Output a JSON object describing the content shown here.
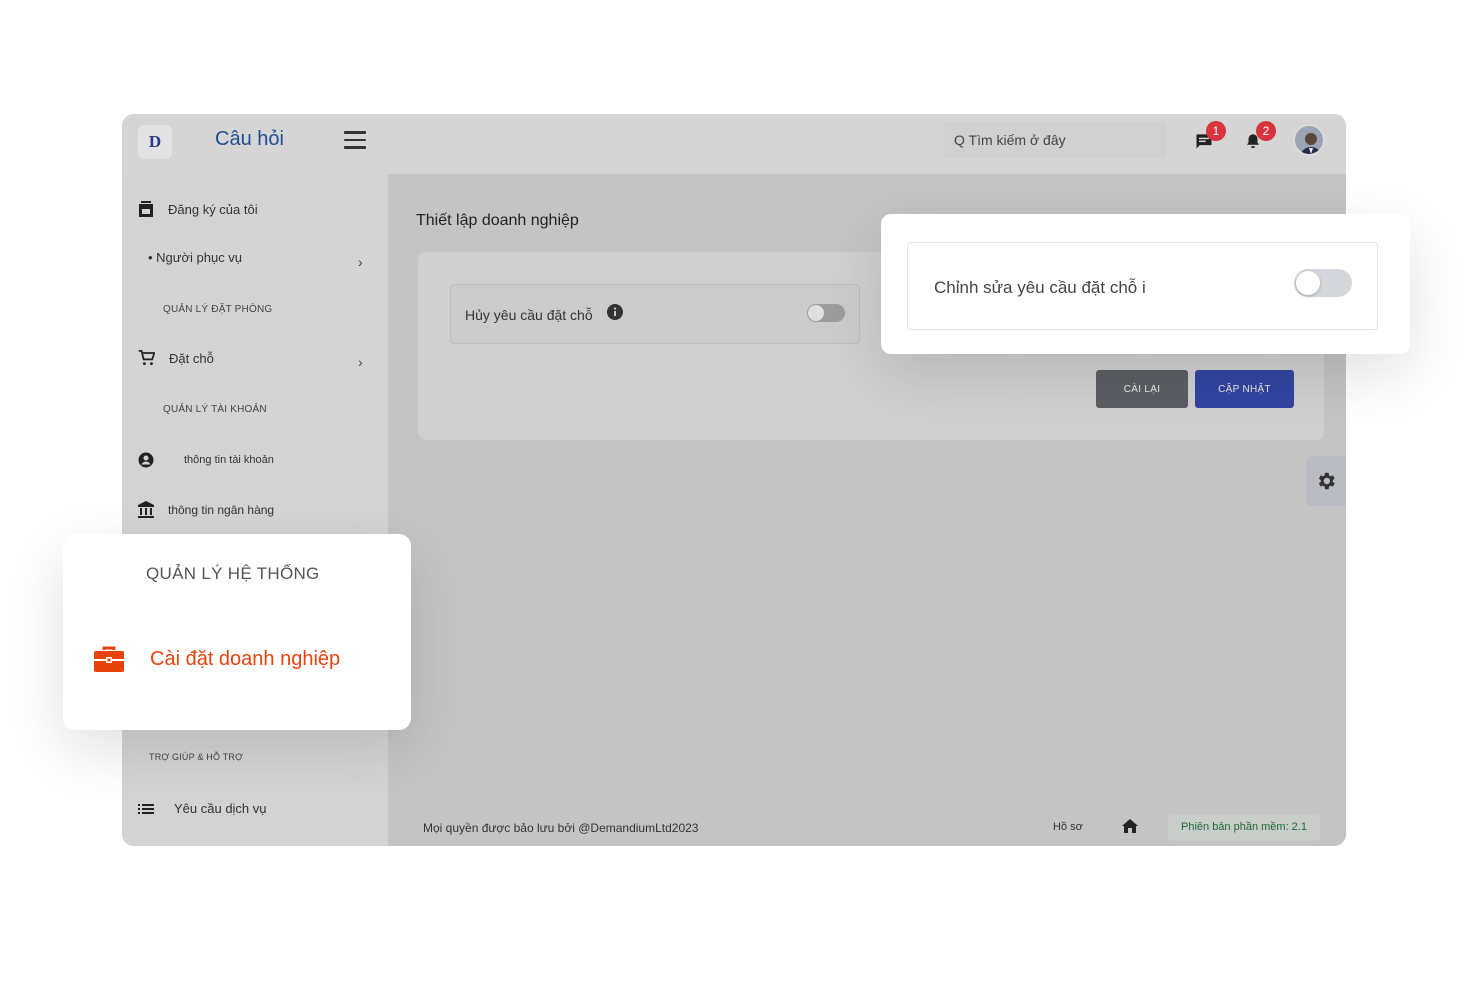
{
  "header": {
    "logo_text": "D",
    "title": "Câu hỏi",
    "search_placeholder": "Q Tìm kiếm ở đây",
    "messages_count": "1",
    "notifications_count": "2"
  },
  "sidebar": {
    "my_registration": "Đăng ký của tôi",
    "servers": "• Người phục vụ",
    "section_booking": "QUẢN LÝ ĐẶT PHÒNG",
    "booking": "Đặt chỗ",
    "section_account": "QUẢN LÝ TÀI KHOẢN",
    "account_info": "thông tin tài khoản",
    "bank_info": "thông tin ngân hàng",
    "section_support": "TRỢ GIÚP & HỖ TRỢ",
    "service_request": "Yêu cầu dịch vụ"
  },
  "main": {
    "page_title": "Thiết lập doanh nghiệp",
    "cancel_booking_label": "Hủy yêu cầu đặt chỗ",
    "cancel_booking_enabled": false,
    "reset_label": "CÀI LẠI",
    "update_label": "CẬP NHẬT"
  },
  "footer": {
    "copyright": "Mọi quyền được bảo lưu bởi @DemandiumLtd2023",
    "profile": "Hồ sơ",
    "version": "Phiên bản phần mềm: 2.1"
  },
  "popout_edit": {
    "label": "Chỉnh sửa yêu cầu đặt chỗ i",
    "enabled": false
  },
  "popout_system": {
    "section": "QUẢN LÝ HỆ THỐNG",
    "business_settings": "Cài đặt doanh nghiệp"
  },
  "colors": {
    "accent_orange": "#e8430d",
    "primary_blue": "#3344a0",
    "badge_red": "#d9343e",
    "title_blue": "#1e4e96"
  },
  "icons": [
    "calendar-icon",
    "cart-icon",
    "account-circle-icon",
    "bank-icon",
    "list-icon",
    "chat-icon",
    "bell-icon",
    "info-icon",
    "gear-icon",
    "home-icon",
    "briefcase-icon",
    "menu-icon"
  ]
}
